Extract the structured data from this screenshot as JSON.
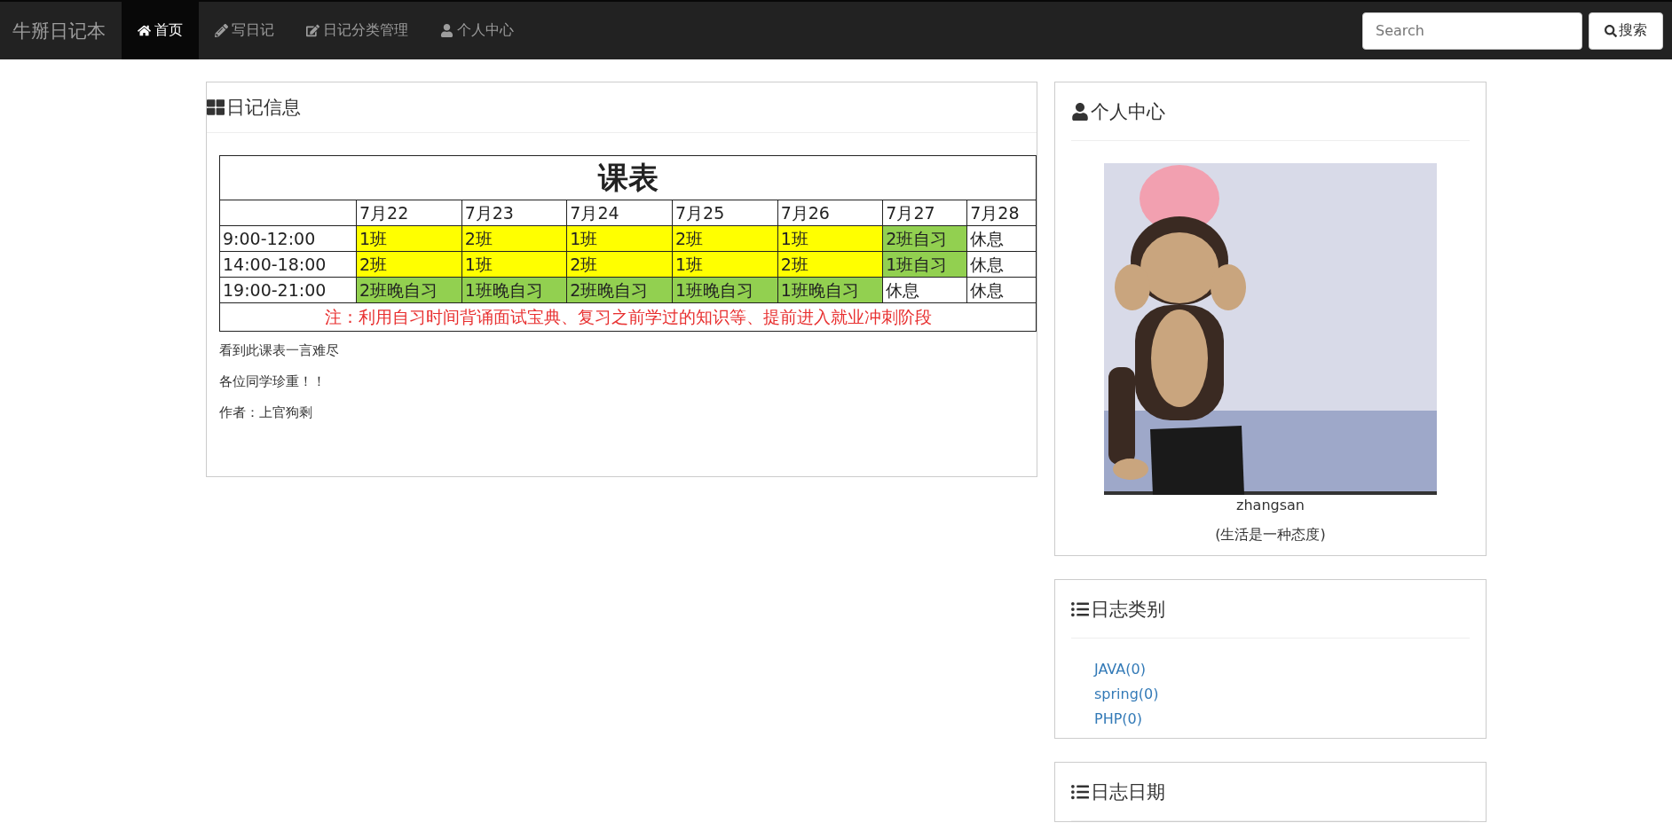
{
  "navbar": {
    "brand": "牛掰日记本",
    "items": [
      {
        "label": "首页",
        "selected": true
      },
      {
        "label": "写日记",
        "selected": false
      },
      {
        "label": "日记分类管理",
        "selected": false
      },
      {
        "label": "个人中心",
        "selected": false
      }
    ],
    "search": {
      "placeholder": "Search",
      "button": "搜索"
    }
  },
  "diary_panel": {
    "title": "日记信息",
    "schedule": {
      "title": "课表",
      "columns": [
        "7月22",
        "7月23",
        "7月24",
        "7月25",
        "7月26",
        "7月27",
        "7月28"
      ],
      "rows": [
        {
          "time": "9:00-12:00",
          "cells": [
            {
              "text": "1班",
              "color": "#ffff00"
            },
            {
              "text": "2班",
              "color": "#ffff00"
            },
            {
              "text": "1班",
              "color": "#ffff00"
            },
            {
              "text": "2班",
              "color": "#ffff00"
            },
            {
              "text": "1班",
              "color": "#ffff00"
            },
            {
              "text": "2班自习",
              "color": "#92d050"
            },
            {
              "text": "休息",
              "color": "#ffffff"
            }
          ]
        },
        {
          "time": "14:00-18:00",
          "cells": [
            {
              "text": "2班",
              "color": "#ffff00"
            },
            {
              "text": "1班",
              "color": "#ffff00"
            },
            {
              "text": "2班",
              "color": "#ffff00"
            },
            {
              "text": "1班",
              "color": "#ffff00"
            },
            {
              "text": "2班",
              "color": "#ffff00"
            },
            {
              "text": "1班自习",
              "color": "#92d050"
            },
            {
              "text": "休息",
              "color": "#ffffff"
            }
          ]
        },
        {
          "time": "19:00-21:00",
          "cells": [
            {
              "text": "2班晚自习",
              "color": "#92d050"
            },
            {
              "text": "1班晚自习",
              "color": "#92d050"
            },
            {
              "text": "2班晚自习",
              "color": "#92d050"
            },
            {
              "text": "1班晚自习",
              "color": "#92d050"
            },
            {
              "text": "1班晚自习",
              "color": "#92d050"
            },
            {
              "text": "休息",
              "color": "#ffffff"
            },
            {
              "text": "休息",
              "color": "#ffffff"
            }
          ]
        }
      ],
      "note": "注：利用自习时间背诵面试宝典、复习之前学过的知识等、提前进入就业冲刺阶段"
    },
    "paragraphs": [
      "看到此课表一言难尽",
      "各位同学珍重！！",
      "作者：上官狗剩"
    ]
  },
  "profile_panel": {
    "title": "个人中心",
    "username": "zhangsan",
    "motto": "(生活是一种态度)"
  },
  "category_panel": {
    "title": "日志类别",
    "links": [
      "JAVA(0)",
      "spring(0)",
      "PHP(0)"
    ]
  },
  "date_panel": {
    "title": "日志日期"
  }
}
